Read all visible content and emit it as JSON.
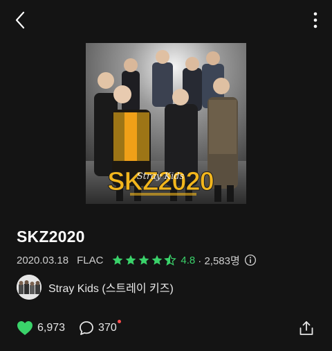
{
  "album": {
    "title": "SKZ2020",
    "release_date": "2020.03.18",
    "format": "FLAC",
    "rating_value": "4.8",
    "rating_fraction": 0.96,
    "rating_count": "· 2,583명",
    "cover_logo_text": "SKZ2020",
    "cover_script_text": "Stray Kids"
  },
  "artist": {
    "name": "Stray Kids (스트레이 키즈)"
  },
  "actions": {
    "like_count": "6,973",
    "comment_count": "370"
  },
  "colors": {
    "background": "#141414",
    "accent_green": "#3ad26a",
    "notification_red": "#ff4d4d",
    "cover_yellow": "#f2b61d"
  },
  "icons": {
    "back": "chevron-left-icon",
    "more": "more-vertical-icon",
    "star": "star-icon",
    "info": "info-icon",
    "like": "heart-icon",
    "comment": "comment-icon",
    "share": "share-icon"
  }
}
